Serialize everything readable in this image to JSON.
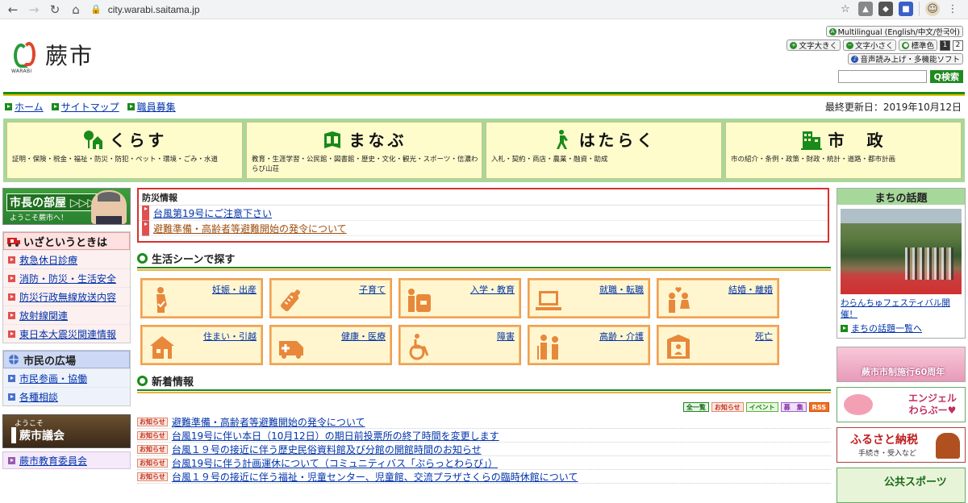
{
  "browser": {
    "url": "city.warabi.saitama.jp"
  },
  "header": {
    "logo_sub": "WARABI",
    "logo_name": "蕨市",
    "multilingual": "Multilingual (English/中文/한국어)",
    "font_large": "文字大きく",
    "font_small": "文字小さく",
    "std_color": "標準色",
    "num1": "1",
    "num2": "2",
    "voice": "音声読み上げ・多機能ソフト",
    "search_button": "Q検索",
    "search_placeholder": ""
  },
  "breadcrumb": {
    "items": [
      "ホーム",
      "サイトマップ",
      "職員募集"
    ],
    "updated": "最終更新日：2019年10月12日"
  },
  "main_nav": [
    {
      "title": "くらす",
      "desc": "証明・保険・税金・福祉・防災・防犯・ペット・環境・ごみ・水道",
      "icon": "tree-house-icon"
    },
    {
      "title": "まなぶ",
      "desc": "教育・生涯学習・公民館・図書館・歴史・文化・観光・スポーツ・信濃わらび山荘",
      "icon": "book-icon"
    },
    {
      "title": "はたらく",
      "desc": "入札・契約・商店・農業・融資・助成",
      "icon": "worker-icon"
    },
    {
      "title": "市　政",
      "desc": "市の紹介・条例・政策・財政・統計・道路・都市計画",
      "icon": "building-icon"
    }
  ],
  "left": {
    "mayor_title": "市長の部屋 ▷▷▷",
    "mayor_sub": "ようこそ蕨市へ！",
    "emergency_title": "いざというときは",
    "emergency_items": [
      "救急休日診療",
      "消防・防災・生活安全",
      "防災行政無線放送内容",
      "放射線関連",
      "東日本大震災関連情報"
    ],
    "plaza_title": "市民の広場",
    "plaza_items": [
      "市民参画・協働",
      "各種相談"
    ],
    "council_small": "ようこそ",
    "council_big": "蕨市議会",
    "edu": "蕨市教育委員会"
  },
  "bousai": {
    "title": "防災情報",
    "items": [
      "台風第19号にご注意下さい",
      "避難準備・高齢者等避難開始の発令について"
    ]
  },
  "life": {
    "title": "生活シーンで探す",
    "scenes": [
      {
        "label": "妊娠・出産",
        "icon": "pregnancy-icon"
      },
      {
        "label": "子育て",
        "icon": "baby-bottle-icon"
      },
      {
        "label": "入学・教育",
        "icon": "school-bag-icon"
      },
      {
        "label": "就職・転職",
        "icon": "computer-icon"
      },
      {
        "label": "結婚・離婚",
        "icon": "couple-icon"
      },
      {
        "label": "住まい・引越",
        "icon": "house-icon"
      },
      {
        "label": "健康・医療",
        "icon": "ambulance-icon"
      },
      {
        "label": "障害",
        "icon": "wheelchair-icon"
      },
      {
        "label": "高齢・介護",
        "icon": "elderly-icon"
      },
      {
        "label": "死亡",
        "icon": "memorial-icon"
      }
    ]
  },
  "news": {
    "title": "新着情報",
    "tags": [
      "全一覧",
      "お知らせ",
      "イベント",
      "募　集",
      "RSS"
    ],
    "badge": "お知らせ",
    "items": [
      "避難準備・高齢者等避難開始の発令について",
      "台風19号に伴い本日（10月12日）の期日前投票所の終了時間を変更します",
      "台風１９号の接近に伴う歴史民俗資料館及び分館の開館時間のお知らせ",
      "台風19号に伴う計画運休について（コミュニティバス「ぷらっとわらび」）",
      "台風１９号の接近に伴う福祉・児童センター、児童館、交流プラザさくらの臨時休館について"
    ]
  },
  "right": {
    "topic_title": "まちの話題",
    "topic_caption": "わらんちゅフェスティバル開催！",
    "topic_more": "まちの話題一覧へ",
    "b1": "蕨市市制施行60周年",
    "b2": "エンジェル\nわらぶー♥",
    "b3_main": "ふるさと納税",
    "b3_sub": "手続き・受入など",
    "b4": "公共スポーツ"
  },
  "colors": {
    "accent_green": "#1a8a1a",
    "nav_bg": "#a6d89a",
    "alert_red": "#d83030",
    "scene_border": "#f0a050"
  }
}
